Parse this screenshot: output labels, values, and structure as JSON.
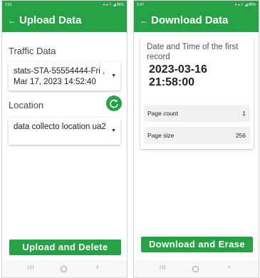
{
  "colors": {
    "accent": "#27a146",
    "text": "#222222",
    "label": "#444444"
  },
  "left_screen": {
    "status_time": "2:51",
    "status_icons": "▾ ◂ ⌔ ◢ 86%",
    "back_icon": "arrow-left",
    "title": "Upload Data",
    "traffic_label": "Traffic Data",
    "traffic_value": "stats-STA-55554444-Fri , Mar 17, 2023 14:52:40",
    "location_label": "Location",
    "location_value": "data collecto location ua2",
    "refresh_icon": "refresh",
    "button_label": "Upload and Delete"
  },
  "right_screen": {
    "status_time": "2:47",
    "status_icons": "▾ ◂ ⌔ ◢ 86%",
    "back_icon": "arrow-left",
    "title": "Download Data",
    "card_title": "Date and Time of the first record",
    "card_value": "2023-03-16 21:58:00",
    "page_count_label": "Page count",
    "page_count_value": "1",
    "page_size_label": "Page size",
    "page_size_value": "256",
    "button_label": "Download and Erase"
  },
  "navbar": {
    "recents": "III",
    "home": "O",
    "back": "<"
  }
}
